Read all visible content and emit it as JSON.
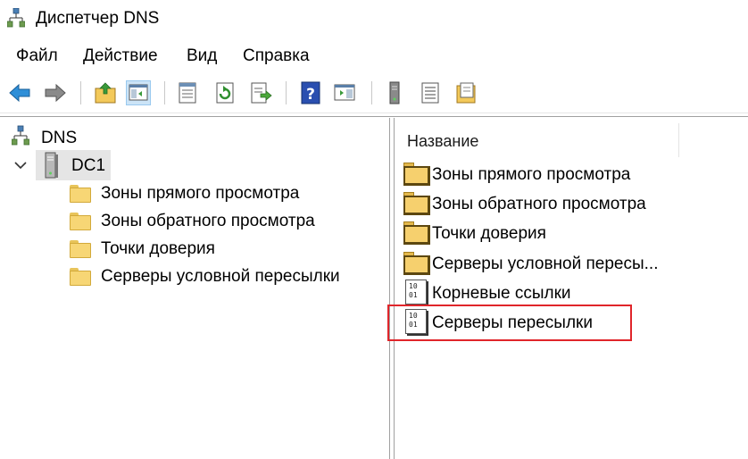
{
  "window": {
    "title": "Диспетчер DNS"
  },
  "menu": {
    "items": [
      "Файл",
      "Действие",
      "Вид",
      "Справка"
    ]
  },
  "toolbar": {
    "buttons": [
      "back-arrow-icon",
      "forward-arrow-icon",
      "up-folder-icon",
      "show-hide-console-tree-icon",
      "properties-icon",
      "refresh-icon",
      "export-list-icon",
      "help-icon",
      "show-hide-action-pane-icon",
      "server-icon",
      "list-view-icon",
      "new-zone-icon"
    ]
  },
  "tree": {
    "root": "DNS",
    "server": "DC1",
    "children": [
      "Зоны прямого просмотра",
      "Зоны обратного просмотра",
      "Точки доверия",
      "Серверы условной пересылки"
    ]
  },
  "list": {
    "column_header": "Название",
    "items": [
      {
        "label": "Зоны прямого просмотра",
        "icon": "folder-icon"
      },
      {
        "label": "Зоны обратного просмотра",
        "icon": "folder-icon"
      },
      {
        "label": "Точки доверия",
        "icon": "folder-icon"
      },
      {
        "label": "Серверы условной пересы...",
        "icon": "folder-icon"
      },
      {
        "label": "Корневые ссылки",
        "icon": "binary-document-icon"
      },
      {
        "label": "Серверы пересылки",
        "icon": "binary-document-icon"
      }
    ]
  },
  "colors": {
    "highlight": "#e0252a",
    "selection": "#e5e5e5",
    "folder": "#f7d675"
  }
}
